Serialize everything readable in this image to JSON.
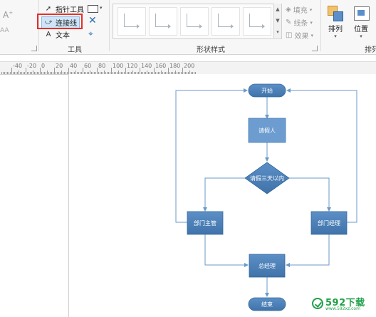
{
  "ribbon": {
    "tools_group": {
      "label": "工具",
      "pointer_label": "指针工具",
      "connector_label": "连接线",
      "text_label": "文本"
    },
    "shape_styles_group": {
      "label": "形状样式",
      "fill_label": "填充",
      "line_label": "线条",
      "effect_label": "效果"
    },
    "arrange_group": {
      "label": "排列",
      "arrange_label": "排列",
      "position_label": "位置"
    }
  },
  "ruler": {
    "ticks": [
      "-40",
      "-20",
      "0",
      "20",
      "40",
      "60",
      "80",
      "100",
      "120",
      "140",
      "160",
      "180",
      "200"
    ]
  },
  "flowchart": {
    "start": "开始",
    "request_leave": "请假人",
    "decision": "请假三天以内",
    "supervisor": "部门主管",
    "manager": "部门经理",
    "general_manager": "总经理",
    "end": "结束"
  },
  "watermark": {
    "text": "592下载",
    "sub": "www.592xz.com"
  },
  "colors": {
    "node_fill": "#4a7fb6",
    "node_fill_light": "#6d9cd0",
    "connector": "#6b9ac8",
    "highlight_frame": "#e2312a",
    "watermark_green": "#21a04a"
  }
}
